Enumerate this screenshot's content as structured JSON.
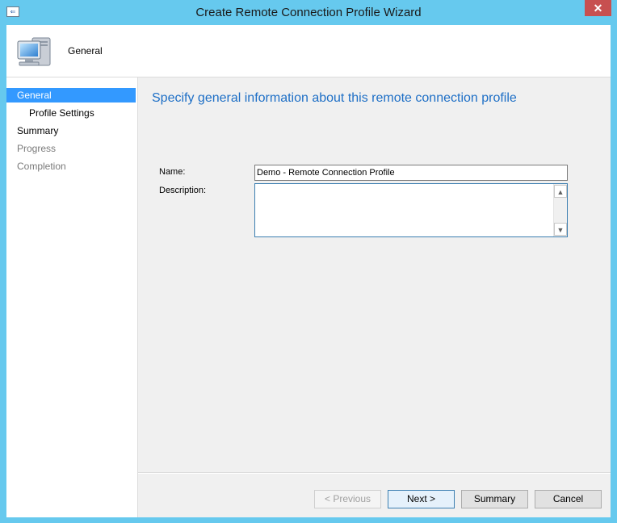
{
  "window": {
    "title": "Create Remote Connection Profile Wizard",
    "close_glyph": "✕"
  },
  "header": {
    "title": "General",
    "icon": "computer-icon"
  },
  "sidebar": {
    "items": [
      {
        "label": "General",
        "state": "selected"
      },
      {
        "label": "Profile Settings",
        "state": "enabled"
      },
      {
        "label": "Summary",
        "state": "enabled"
      },
      {
        "label": "Progress",
        "state": "disabled"
      },
      {
        "label": "Completion",
        "state": "disabled"
      }
    ]
  },
  "main": {
    "heading": "Specify general information about this remote connection profile",
    "name_label": "Name:",
    "name_value": "Demo - Remote Connection Profile",
    "description_label": "Description:",
    "description_value": ""
  },
  "buttons": {
    "previous": "< Previous",
    "next": "Next >",
    "summary": "Summary",
    "cancel": "Cancel"
  },
  "colors": {
    "titlebar": "#66c9ee",
    "selected": "#3399ff",
    "heading": "#1e6fc6"
  }
}
